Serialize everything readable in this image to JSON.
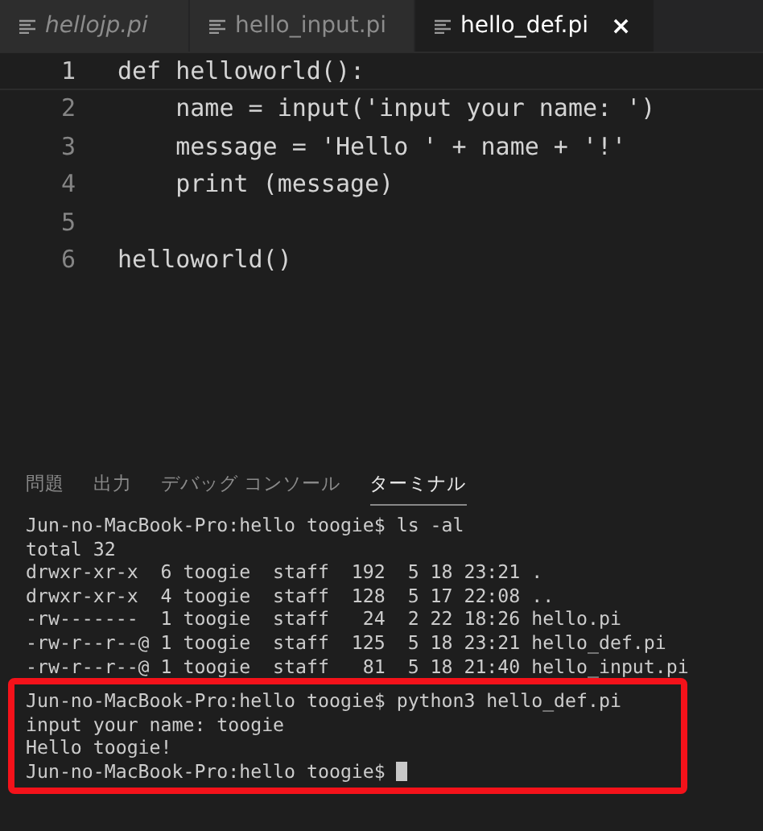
{
  "tabs": [
    {
      "label": "hellojp.pi",
      "preview": true,
      "selected": false
    },
    {
      "label": "hello_input.pi",
      "preview": false,
      "selected": false
    },
    {
      "label": "hello_def.pi",
      "preview": false,
      "selected": true
    }
  ],
  "close_glyph": "×",
  "editor": {
    "lines": [
      {
        "number": "1",
        "text": "def helloworld():",
        "current": true
      },
      {
        "number": "2",
        "text": "    name = input('input your name: ')",
        "current": false
      },
      {
        "number": "3",
        "text": "    message = 'Hello ' + name + '!'",
        "current": false
      },
      {
        "number": "4",
        "text": "    print (message)",
        "current": false
      },
      {
        "number": "5",
        "current": false
      },
      {
        "number": "6",
        "text": "helloworld()",
        "current": false
      }
    ]
  },
  "panel": {
    "tabs": [
      {
        "label": "問題",
        "selected": false
      },
      {
        "label": "出力",
        "selected": false
      },
      {
        "label": "デバッグ コンソール",
        "selected": false
      },
      {
        "label": "ターミナル",
        "selected": true
      }
    ],
    "terminal": {
      "lines": [
        "Jun-no-MacBook-Pro:hello toogie$ ls -al",
        "total 32",
        "drwxr-xr-x  6 toogie  staff  192  5 18 23:21 .",
        "drwxr-xr-x  4 toogie  staff  128  5 17 22:08 ..",
        "-rw-------  1 toogie  staff   24  2 22 18:26 hello.pi",
        "-rw-r--r--@ 1 toogie  staff  125  5 18 23:21 hello_def.pi",
        "-rw-r--r--@ 1 toogie  staff   81  5 18 21:40 hello_input.pi"
      ],
      "highlighted_lines": [
        "Jun-no-MacBook-Pro:hello toogie$ python3 hello_def.pi",
        "input your name: toogie",
        "Hello toogie!",
        "Jun-no-MacBook-Pro:hello toogie$"
      ],
      "cursor": true
    }
  }
}
